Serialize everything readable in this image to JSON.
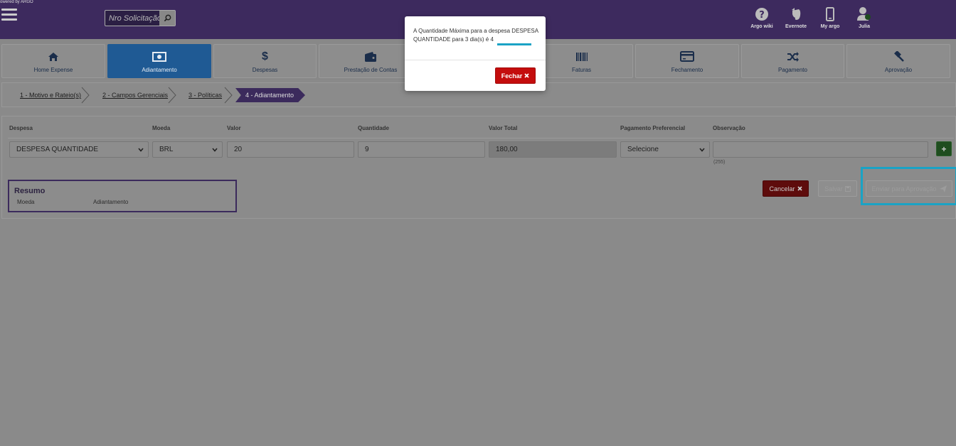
{
  "header": {
    "powered": "owered by ARGO",
    "search_placeholder": "Nro Solicitação",
    "icons": [
      {
        "label": "Argo wiki",
        "icon": "question-circle-icon"
      },
      {
        "label": "Evernote",
        "icon": "evernote-icon"
      },
      {
        "label": "My argo",
        "icon": "mobile-icon"
      },
      {
        "label": "Julia",
        "icon": "user-icon"
      }
    ]
  },
  "modules": [
    {
      "label": "Home Expense",
      "icon": "home-icon"
    },
    {
      "label": "Adiantamento",
      "icon": "money-icon",
      "active": true
    },
    {
      "label": "Despesas",
      "icon": "dollar-icon",
      "glyph": "$"
    },
    {
      "label": "Prestação de Contas",
      "icon": "wallet-icon"
    },
    {
      "label": "Faturas",
      "icon": "barcode-icon"
    },
    {
      "label": "Fechamento",
      "icon": "credit-card-icon"
    },
    {
      "label": "Pagamento",
      "icon": "random-icon"
    },
    {
      "label": "Aprovação",
      "icon": "gavel-icon"
    }
  ],
  "steps": [
    {
      "label": "1 - Motivo e Rateio(s)"
    },
    {
      "label": "2 - Campos Gerenciais"
    },
    {
      "label": "3 - Políticas"
    },
    {
      "label": "4 - Adiantamento",
      "active": true
    }
  ],
  "form": {
    "labels": {
      "despesa": "Despesa",
      "moeda": "Moeda",
      "valor": "Valor",
      "quantidade": "Quantidade",
      "valor_total": "Valor Total",
      "pagamento": "Pagamento Preferencial",
      "observacao": "Observação"
    },
    "values": {
      "despesa": "DESPESA QUANTIDADE",
      "moeda": "BRL",
      "valor": "20",
      "quantidade": "9",
      "valor_total": "180,00",
      "pagamento": "Selecione",
      "observacao": ""
    },
    "char_count": "(255)",
    "add": "+"
  },
  "resumo": {
    "title": "Resumo",
    "col_moeda": "Moeda",
    "col_adiantamento": "Adiantamento"
  },
  "actions": {
    "cancelar": "Cancelar",
    "salvar": "Salvar",
    "enviar": "Enviar para Aprovação"
  },
  "modal": {
    "message": "A Quantidade Máxima para a despesa DESPESA QUANTIDADE para 3 dia(s) é 4",
    "close_label": "Fechar"
  },
  "colors": {
    "header_bg": "#3d2a5e",
    "active_module": "#1f5a94",
    "highlight": "#1aa3c5",
    "danger": "#c40d0d",
    "success": "#1f4d1f"
  }
}
